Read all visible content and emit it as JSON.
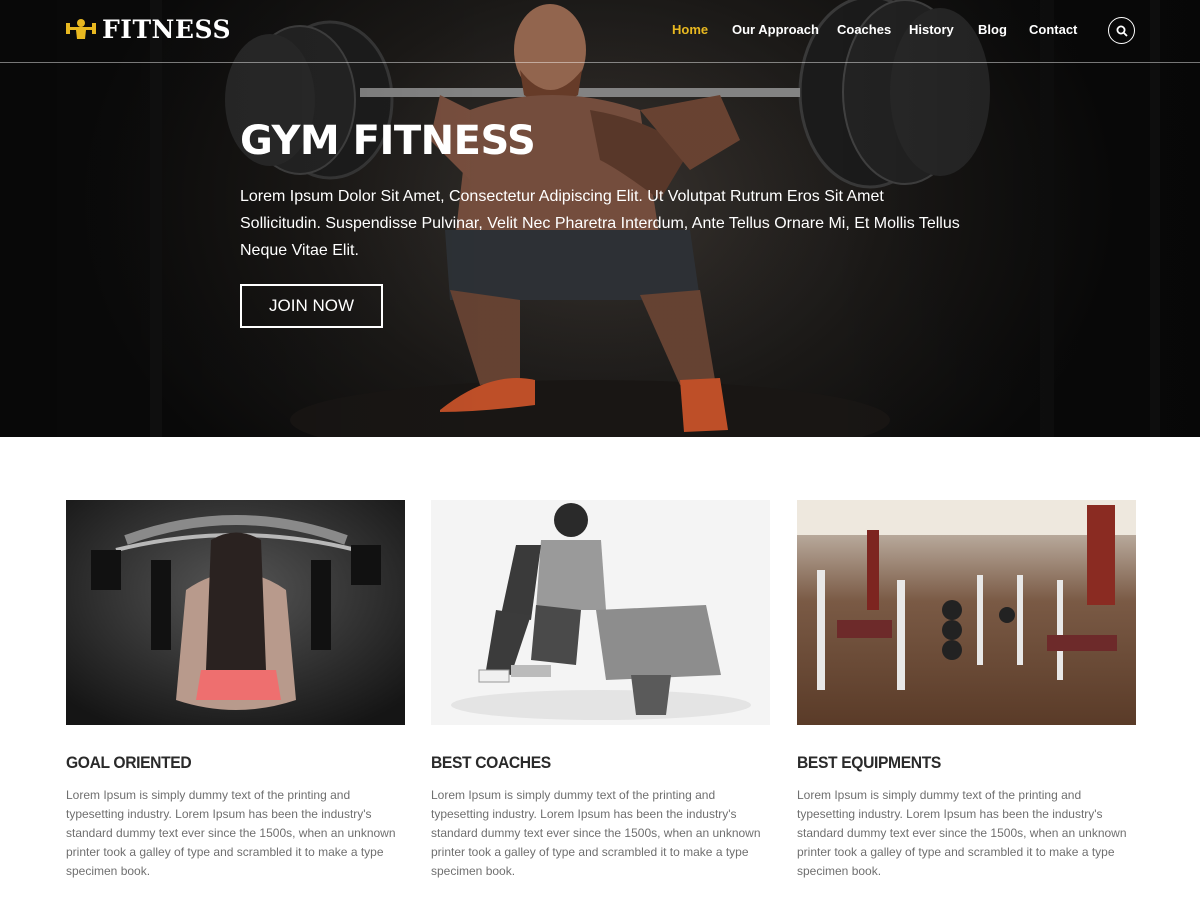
{
  "brand": {
    "name": "FITNESS",
    "logo_icon": "dumbbell-person-icon",
    "accent_color": "#e8b820"
  },
  "nav": {
    "items": [
      {
        "label": "Home",
        "active": true
      },
      {
        "label": "Our Approach",
        "active": false
      },
      {
        "label": "Coaches",
        "active": false
      },
      {
        "label": "History",
        "active": false
      },
      {
        "label": "Blog",
        "active": false
      },
      {
        "label": "Contact",
        "active": false
      }
    ],
    "search_icon": "search-icon"
  },
  "hero": {
    "title": "GYM FITNESS",
    "description": "Lorem Ipsum Dolor Sit Amet, Consectetur Adipiscing Elit. Ut Volutpat Rutrum Eros Sit Amet Sollicitudin. Suspendisse Pulvinar, Velit Nec Pharetra Interdum, Ante Tellus Ornare Mi, Et Mollis Tellus Neque Vitae Elit.",
    "cta_label": "JOIN NOW"
  },
  "features": [
    {
      "title": "GOAL ORIENTED",
      "text": "Lorem Ipsum is simply dummy text of the printing and typesetting industry. Lorem Ipsum has been the industry's standard dummy text ever since the 1500s, when an unknown printer took a galley of type and scrambled it to make a type specimen book."
    },
    {
      "title": "BEST COACHES",
      "text": "Lorem Ipsum is simply dummy text of the printing and typesetting industry. Lorem Ipsum has been the industry's standard dummy text ever since the 1500s, when an unknown printer took a galley of type and scrambled it to make a type specimen book."
    },
    {
      "title": "BEST EQUIPMENTS",
      "text": "Lorem Ipsum is simply dummy text of the printing and typesetting industry. Lorem Ipsum has been the industry's standard dummy text ever since the 1500s, when an unknown printer took a galley of type and scrambled it to make a type specimen book."
    }
  ]
}
